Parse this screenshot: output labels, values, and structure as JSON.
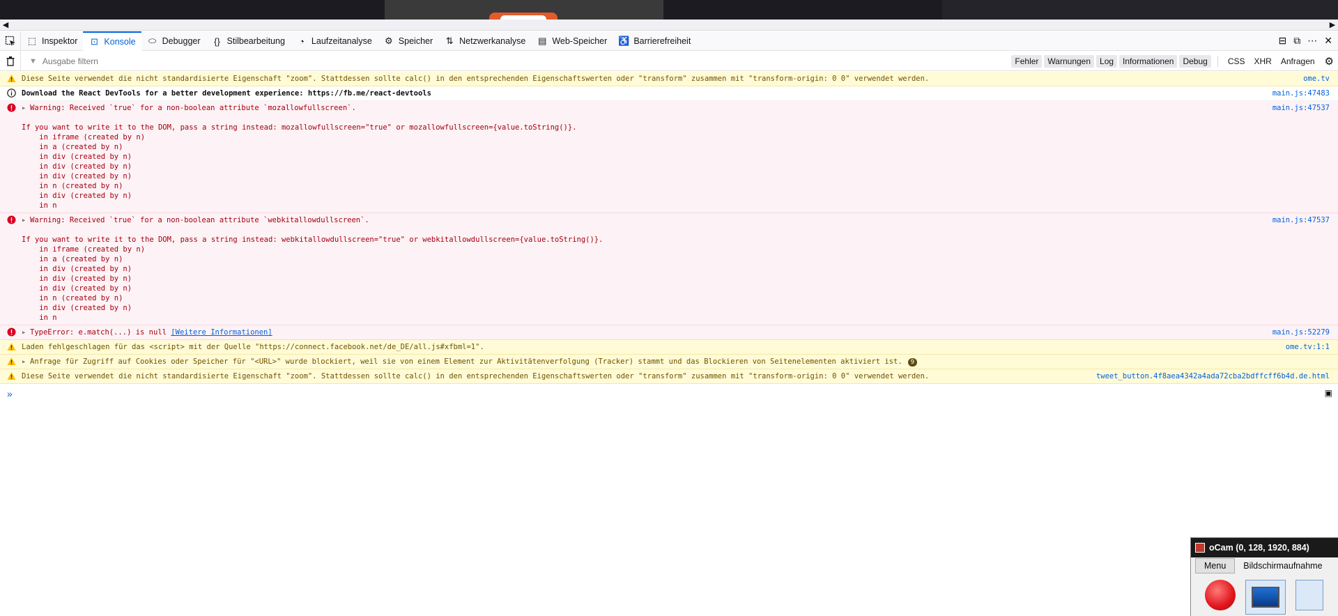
{
  "tabs": [
    {
      "label": "Inspektor",
      "icon": "inspector-icon"
    },
    {
      "label": "Konsole",
      "icon": "console-icon",
      "selected": true
    },
    {
      "label": "Debugger",
      "icon": "debugger-icon"
    },
    {
      "label": "Stilbearbeitung",
      "icon": "style-editor-icon"
    },
    {
      "label": "Laufzeitanalyse",
      "icon": "performance-icon"
    },
    {
      "label": "Speicher",
      "icon": "memory-icon"
    },
    {
      "label": "Netzwerkanalyse",
      "icon": "network-icon"
    },
    {
      "label": "Web-Speicher",
      "icon": "storage-icon"
    },
    {
      "label": "Barrierefreiheit",
      "icon": "accessibility-icon"
    }
  ],
  "filter": {
    "placeholder": "Ausgabe filtern"
  },
  "levels": [
    "Fehler",
    "Warnungen",
    "Log",
    "Informationen",
    "Debug"
  ],
  "net_filters": [
    "CSS",
    "XHR",
    "Anfragen"
  ],
  "messages": [
    {
      "type": "warn",
      "text": "Diese Seite verwendet die nicht standardisierte Eigenschaft \"zoom\". Stattdessen sollte calc() in den entsprechenden Eigenschaftswerten oder \"transform\" zusammen mit \"transform-origin: 0 0\" verwendet werden.",
      "source": "ome.tv"
    },
    {
      "type": "info",
      "text": "Download the React DevTools for a better development experience: https://fb.me/react-devtools",
      "source": "main.js:47483"
    },
    {
      "type": "err",
      "text": "Warning: Received `true` for a non-boolean attribute `mozallowfullscreen`.",
      "detail": "If you want to write it to the DOM, pass a string instead: mozallowfullscreen=\"true\" or mozallowfullscreen={value.toString()}.",
      "trace": [
        "in iframe (created by n)",
        "in a (created by n)",
        "in div (created by n)",
        "in div (created by n)",
        "in div (created by n)",
        "in n (created by n)",
        "in div (created by n)",
        "in n"
      ],
      "source": "main.js:47537"
    },
    {
      "type": "err",
      "text": "Warning: Received `true` for a non-boolean attribute `webkitallowdullscreen`.",
      "detail": "If you want to write it to the DOM, pass a string instead: webkitallowdullscreen=\"true\" or webkitallowdullscreen={value.toString()}.",
      "trace": [
        "in iframe (created by n)",
        "in a (created by n)",
        "in div (created by n)",
        "in div (created by n)",
        "in div (created by n)",
        "in n (created by n)",
        "in div (created by n)",
        "in n"
      ],
      "source": "main.js:47537"
    },
    {
      "type": "err",
      "text": "TypeError: e.match(...) is null",
      "link": "[Weitere Informationen]",
      "source": "main.js:52279"
    },
    {
      "type": "warn",
      "text": "Laden fehlgeschlagen für das <script> mit der Quelle \"https://connect.facebook.net/de_DE/all.js#xfbml=1\".",
      "source": "ome.tv:1:1"
    },
    {
      "type": "warn",
      "text": "Anfrage für Zugriff auf Cookies oder Speicher für \"<URL>\" wurde blockiert, weil sie von einem Element zur Aktivitätenverfolgung (Tracker) stammt und das Blockieren von Seitenelementen aktiviert ist.",
      "badge": "9",
      "source": ""
    },
    {
      "type": "warn",
      "text": "Diese Seite verwendet die nicht standardisierte Eigenschaft \"zoom\". Stattdessen sollte calc() in den entsprechenden Eigenschaftswerten oder \"transform\" zusammen mit \"transform-origin: 0 0\" verwendet werden.",
      "source": "tweet_button.4f8aea4342a4ada72cba2bdffcff6b4d.de.html"
    }
  ],
  "ocam": {
    "title": "oCam (0, 128, 1920, 884)",
    "menu": "Menu",
    "tab": "Bildschirmaufnahme"
  },
  "colors": {
    "accent": "#0061e0",
    "error_bg": "#fdf2f5",
    "warn_bg": "#fffbd6"
  }
}
